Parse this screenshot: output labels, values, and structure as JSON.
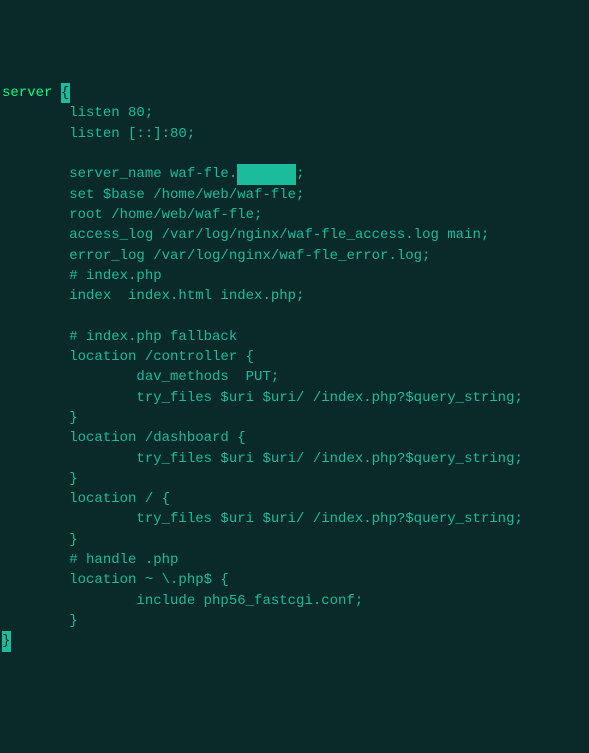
{
  "code": {
    "l1_keyword": "server",
    "l1_brace": "{",
    "l2": "        listen 80;",
    "l3": "        listen [::]:80;",
    "l4": "",
    "l5_prefix": "        server_name waf-fle.",
    "l5_redacted": "       ",
    "l5_suffix": ";",
    "l6": "        set $base /home/web/waf-fle;",
    "l7": "        root /home/web/waf-fle;",
    "l8": "        access_log /var/log/nginx/waf-fle_access.log main;",
    "l9": "        error_log /var/log/nginx/waf-fle_error.log;",
    "l10": "        # index.php",
    "l11": "        index  index.html index.php;",
    "l12": "",
    "l13": "        # index.php fallback",
    "l14": "        location /controller {",
    "l15": "                dav_methods  PUT;",
    "l16": "                try_files $uri $uri/ /index.php?$query_string;",
    "l17": "        }",
    "l18": "        location /dashboard {",
    "l19": "                try_files $uri $uri/ /index.php?$query_string;",
    "l20": "        }",
    "l21": "        location / {",
    "l22": "                try_files $uri $uri/ /index.php?$query_string;",
    "l23": "        }",
    "l24": "        # handle .php",
    "l25": "        location ~ \\.php$ {",
    "l26": "                include php56_fastcgi.conf;",
    "l27": "        }",
    "l28_brace": "}"
  }
}
